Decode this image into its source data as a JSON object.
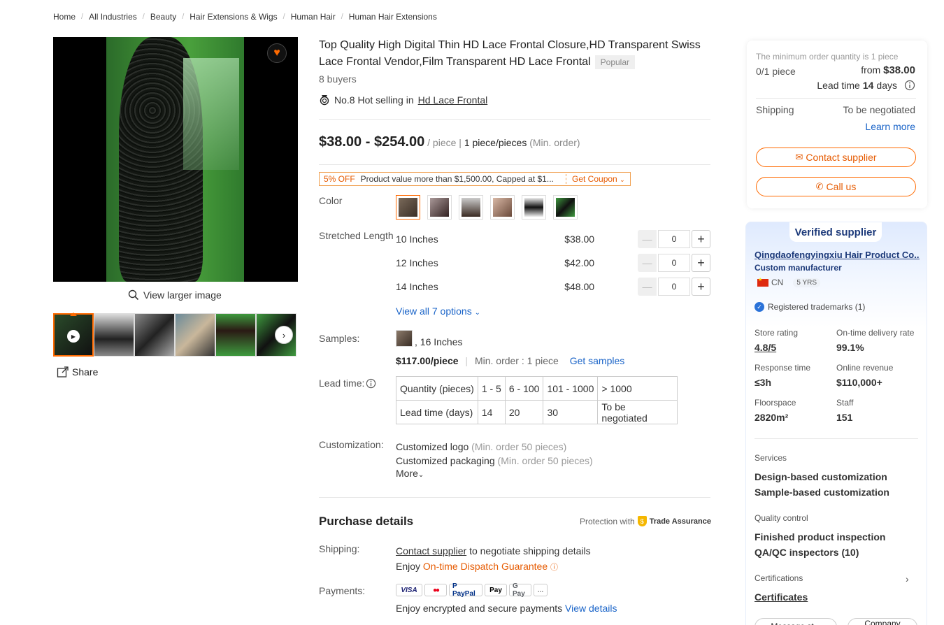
{
  "breadcrumb": [
    "Home",
    "All Industries",
    "Beauty",
    "Hair Extensions & Wigs",
    "Human Hair",
    "Human Hair Extensions"
  ],
  "gallery": {
    "view_larger": "View larger image",
    "share": "Share",
    "thumb_count": 6
  },
  "product": {
    "title": "Top Quality High Digital Thin HD Lace Frontal Closure,HD Transparent Swiss Lace Frontal Vendor,Film Transparent HD Lace Frontal",
    "badge": "Popular",
    "buyers": "8 buyers",
    "hot_prefix": "No.8 Hot selling in",
    "hot_link": "Hd Lace Frontal",
    "price_range": "$38.00 - $254.00",
    "price_unit": "/ piece |",
    "min_qty": "1 piece/pieces",
    "min_note": "(Min. order)",
    "coupon_off": "5% OFF",
    "coupon_text": "Product value more than $1,500.00, Capped at $1...",
    "coupon_get": "Get Coupon",
    "color_label": "Color",
    "length_label": "Stretched Length",
    "lengths": [
      {
        "size": "10 Inches",
        "price": "$38.00",
        "qty": "0"
      },
      {
        "size": "12 Inches",
        "price": "$42.00",
        "qty": "0"
      },
      {
        "size": "14 Inches",
        "price": "$48.00",
        "qty": "0"
      }
    ],
    "view_all": "View all 7 options",
    "samples_label": "Samples:",
    "sample_size": ", 16 Inches",
    "sample_price": "$117.00/piece",
    "sample_min": "Min. order : 1 piece",
    "get_samples": "Get samples",
    "lead_label": "Lead time:",
    "lead_table": {
      "row1": [
        "Quantity (pieces)",
        "1 - 5",
        "6 - 100",
        "101 - 1000",
        "> 1000"
      ],
      "row2": [
        "Lead time (days)",
        "14",
        "20",
        "30",
        "To be negotiated"
      ]
    },
    "custom_label": "Customization:",
    "custom_logo": "Customized logo",
    "custom_logo_note": "(Min. order 50 pieces)",
    "custom_pack": "Customized packaging",
    "custom_pack_note": "(Min. order 50 pieces)",
    "more": "More"
  },
  "purchase": {
    "heading": "Purchase details",
    "protection": "Protection with",
    "trade_assurance": "Trade Assurance",
    "shipping_label": "Shipping:",
    "contact_link": "Contact supplier",
    "shipping_text": "to negotiate shipping details",
    "enjoy": "Enjoy",
    "dispatch": "On-time Dispatch Guarantee",
    "payments_label": "Payments:",
    "pay_methods": [
      "VISA",
      "●●",
      "P PayPal",
      "Pay",
      "G Pay",
      "..."
    ],
    "secure_text": "Enjoy encrypted and secure payments",
    "view_details": "View details"
  },
  "order_card": {
    "moq_note": "The minimum order quantity is 1 piece",
    "count": "0/1 piece",
    "from": "from",
    "from_price": "$38.00",
    "lead_prefix": "Lead time",
    "lead_days": "14",
    "lead_suffix": "days",
    "shipping_label": "Shipping",
    "shipping_val": "To be negotiated",
    "learn_more": "Learn more",
    "contact": "Contact supplier",
    "call": "Call us"
  },
  "supplier": {
    "verified": "Verified supplier",
    "name": "Qingdaofengyingxiu Hair Product Co...",
    "type": "Custom manufacturer",
    "country": "CN",
    "years": "5 YRS",
    "trademarks": "Registered trademarks (1)",
    "stats": [
      {
        "label": "Store rating",
        "value": "4.8/5"
      },
      {
        "label": "On-time delivery rate",
        "value": "99.1%"
      },
      {
        "label": "Response time",
        "value": "≤3h"
      },
      {
        "label": "Online revenue",
        "value": "$110,000+"
      },
      {
        "label": "Floorspace",
        "value": "2820m²"
      },
      {
        "label": "Staff",
        "value": "151"
      }
    ],
    "services_label": "Services",
    "services": [
      "Design-based customization",
      "Sample-based customization"
    ],
    "qc_label": "Quality control",
    "qc": [
      "Finished product inspection",
      "QA/QC inspectors (10)"
    ],
    "cert_label": "Certifications",
    "cert_link": "Certificates",
    "btn_left": "Message st...",
    "btn_right": "Company"
  },
  "colors": {
    "accent": "#ff6a00",
    "link": "#1a64c8"
  }
}
